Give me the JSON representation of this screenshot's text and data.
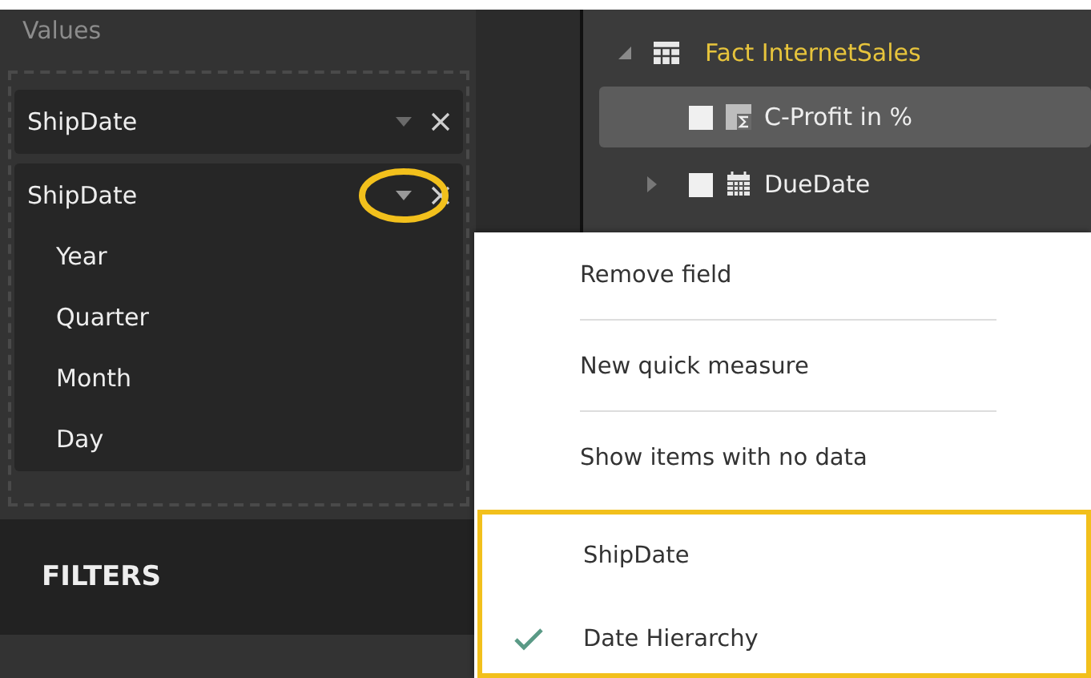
{
  "values_pane": {
    "title": "Values",
    "fields": [
      {
        "name": "ShipDate",
        "expanded": false
      },
      {
        "name": "ShipDate",
        "expanded": true,
        "children": [
          "Year",
          "Quarter",
          "Month",
          "Day"
        ]
      }
    ]
  },
  "filters_pane": {
    "title": "FILTERS"
  },
  "fields_pane": {
    "table": {
      "name": "Fact InternetSales",
      "expanded": true
    },
    "items": [
      {
        "name": "C-Profit in %",
        "kind": "measure",
        "checked": false,
        "selected": true,
        "expandable": false
      },
      {
        "name": "DueDate",
        "kind": "date",
        "checked": false,
        "selected": false,
        "expandable": true
      }
    ]
  },
  "context_menu": {
    "items": [
      {
        "label": "Remove field",
        "kind": "action"
      },
      {
        "label": "New quick measure",
        "kind": "action"
      },
      {
        "label": "Show items with no data",
        "kind": "action"
      },
      {
        "label": "ShipDate",
        "kind": "option",
        "selected": false
      },
      {
        "label": "Date Hierarchy",
        "kind": "option",
        "selected": true
      }
    ]
  }
}
